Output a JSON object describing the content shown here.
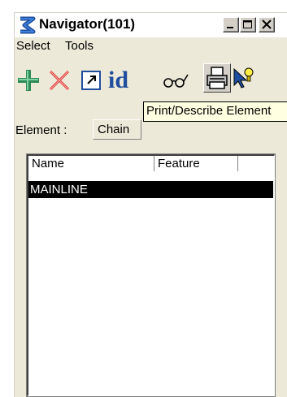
{
  "window": {
    "title": "Navigator(101)",
    "controls": [
      "minimize-icon",
      "maximize-icon",
      "close-icon"
    ]
  },
  "menu": {
    "items": [
      {
        "label": "Select"
      },
      {
        "label": "Tools"
      }
    ]
  },
  "toolbar": {
    "tools": [
      {
        "icon": "add-icon"
      },
      {
        "icon": "delete-icon"
      },
      {
        "icon": "window-select-icon"
      },
      {
        "icon": "id-icon",
        "text": "id"
      },
      {
        "icon": "review-glasses-icon"
      },
      {
        "icon": "printer-icon"
      },
      {
        "icon": "pointer-highlight-icon"
      }
    ],
    "tooltip": "Print/Describe Element"
  },
  "element": {
    "label": "Element :",
    "value": "Chain"
  },
  "list": {
    "columns": [
      "Name",
      "Feature"
    ],
    "rows": [
      {
        "name": "MAINLINE",
        "feature": "",
        "selected": true
      }
    ]
  },
  "colors": {
    "window_bg": "#ece9d8",
    "selection_bg": "#000000",
    "selection_fg": "#ffffff",
    "tooltip_bg": "#ffffe1",
    "add_icon": "#2e8b57",
    "delete_icon": "#e03030",
    "id_icon": "#1f4e9e"
  }
}
